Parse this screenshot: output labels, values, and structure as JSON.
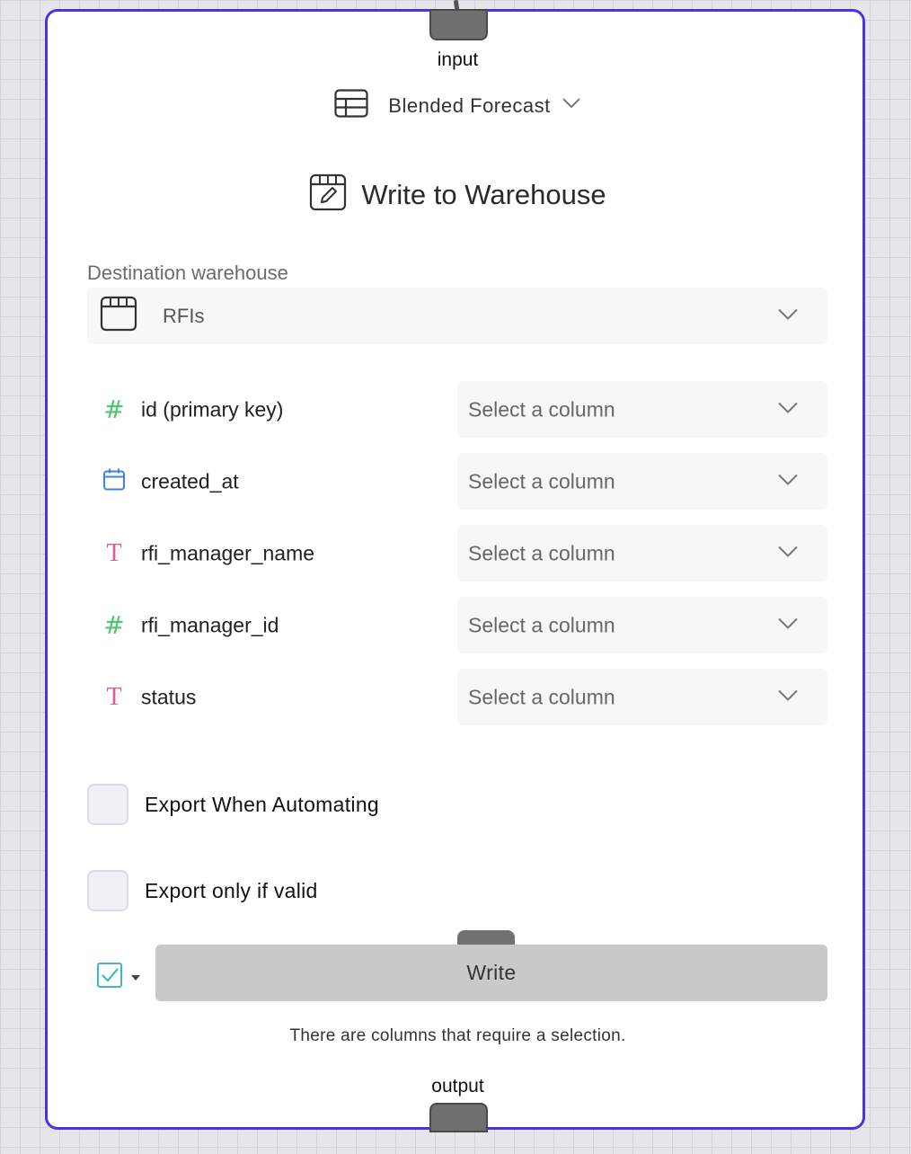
{
  "node": {
    "input_label": "input",
    "output_label": "output",
    "source_table": "Blended Forecast",
    "title": "Write to Warehouse",
    "accent_color": "#4a35d8"
  },
  "destination": {
    "label": "Destination warehouse",
    "value": "RFIs"
  },
  "mappings": [
    {
      "field": "id (primary key)",
      "type": "number",
      "placeholder": "Select a column"
    },
    {
      "field": "created_at",
      "type": "date",
      "placeholder": "Select a column"
    },
    {
      "field": "rfi_manager_name",
      "type": "text",
      "placeholder": "Select a column"
    },
    {
      "field": "rfi_manager_id",
      "type": "number",
      "placeholder": "Select a column"
    },
    {
      "field": "status",
      "type": "text",
      "placeholder": "Select a column"
    }
  ],
  "options": {
    "export_when_automating": {
      "label": "Export When Automating",
      "checked": false
    },
    "export_only_if_valid": {
      "label": "Export only if valid",
      "checked": false
    }
  },
  "action": {
    "write_label": "Write",
    "hint": "There are columns that require a selection."
  },
  "icons": {
    "source": "table-icon",
    "title": "warehouse-edit-icon",
    "destination": "warehouse-icon",
    "number": "hash-icon",
    "date": "calendar-icon",
    "text": "text-type-icon",
    "mode": "checkbox-check-icon"
  }
}
